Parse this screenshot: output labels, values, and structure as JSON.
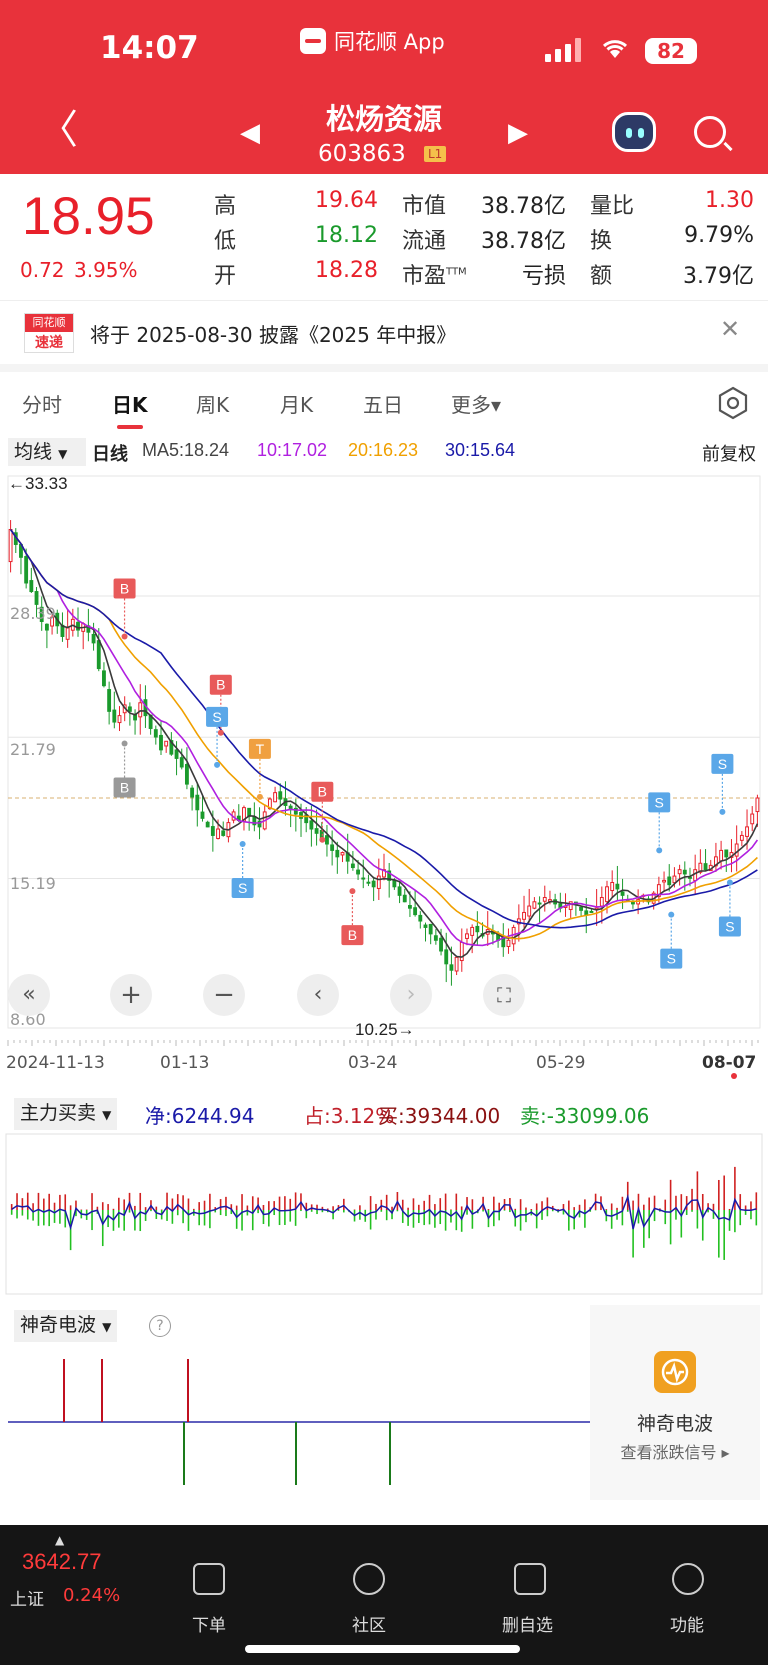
{
  "status_bar": {
    "time": "14:07",
    "app_label": "同花顺 App",
    "battery": "82"
  },
  "header": {
    "stock_name": "松炀资源",
    "stock_code": "603863",
    "level_badge": "L1"
  },
  "quote": {
    "price": "18.95",
    "change": "0.72",
    "change_pct": "3.95%",
    "high_label": "高",
    "high": "19.64",
    "low_label": "低",
    "low": "18.12",
    "open_label": "开",
    "open": "18.28",
    "mktcap_label": "市值",
    "mktcap": "38.78亿",
    "float_label": "流通",
    "float": "38.78亿",
    "pe_label": "市盈",
    "pe_sup": "TTM",
    "pe": "亏损",
    "volratio_label": "量比",
    "volratio": "1.30",
    "turnover_label": "换",
    "turnover": "9.79%",
    "amount_label": "额",
    "amount": "3.79亿"
  },
  "notice": {
    "logo_top": "同花顺",
    "logo_bottom": "速递",
    "text": "将于 2025-08-30 披露《2025 年中报》"
  },
  "tabs": [
    "分时",
    "日K",
    "周K",
    "月K",
    "五日",
    "更多▾"
  ],
  "ma_bar": {
    "selector": "均线",
    "period": "日线",
    "ma5": "MA5:18.24",
    "ma10": "10:17.02",
    "ma20": "20:16.23",
    "ma30": "30:15.64",
    "adjust": "前复权"
  },
  "chart_data": {
    "type": "candlestick",
    "y_ticks": [
      "28.39",
      "21.79",
      "15.19",
      "8.60"
    ],
    "high_marker": "←33.33",
    "low_marker": "10.25→",
    "x_ticks": [
      "2024-11-13",
      "01-13",
      "03-24",
      "05-29",
      "08-07"
    ],
    "current_price_line": 18.95,
    "close_series": [
      31.5,
      30.8,
      30.2,
      29.0,
      28.6,
      28.0,
      27.2,
      26.8,
      27.4,
      27.0,
      26.5,
      26.9,
      27.3,
      26.8,
      27.1,
      26.7,
      26.2,
      25.0,
      24.2,
      23.0,
      22.5,
      22.8,
      23.3,
      23.0,
      22.6,
      23.4,
      22.8,
      22.2,
      21.8,
      21.2,
      21.6,
      21.0,
      20.8,
      20.4,
      19.6,
      19.0,
      18.4,
      18.0,
      17.6,
      17.2,
      17.5,
      17.2,
      17.8,
      18.3,
      17.9,
      18.5,
      18.1,
      17.7,
      17.6,
      18.3,
      18.9,
      19.2,
      18.9,
      18.6,
      18.4,
      18.2,
      18.0,
      17.8,
      17.5,
      17.3,
      17.0,
      16.8,
      16.5,
      16.2,
      16.4,
      16.0,
      15.7,
      15.4,
      15.2,
      15.0,
      14.8,
      15.3,
      15.6,
      15.1,
      14.8,
      14.4,
      14.1,
      13.8,
      13.5,
      13.2,
      12.9,
      12.6,
      12.3,
      11.8,
      11.2,
      10.9,
      11.5,
      12.2,
      12.6,
      12.9,
      12.7,
      12.5,
      12.8,
      12.6,
      12.3,
      12.0,
      12.3,
      12.9,
      13.3,
      13.6,
      13.9,
      14.1,
      14.0,
      14.3,
      14.2,
      14.0,
      13.8,
      13.9,
      14.1,
      14.0,
      13.7,
      13.5,
      13.6,
      13.8,
      14.3,
      14.8,
      15.0,
      14.7,
      14.4,
      14.2,
      14.0,
      14.2,
      14.4,
      14.1,
      14.5,
      14.9,
      15.1,
      14.9,
      15.3,
      15.6,
      15.4,
      15.2,
      15.6,
      15.9,
      15.6,
      15.8,
      16.2,
      16.5,
      16.2,
      16.4,
      16.8,
      17.2,
      17.6,
      18.2,
      18.95
    ],
    "ma_colors": {
      "ma5": "#3a3a3a",
      "ma10": "#b020e0",
      "ma20": "#f0a000",
      "ma30": "#1a1aa8"
    },
    "signals": [
      {
        "label": "B",
        "x": 0.155,
        "price": 26.5,
        "pos": "above",
        "color": "#e85a5a"
      },
      {
        "label": "B",
        "x": 0.155,
        "price": 21.5,
        "pos": "below",
        "color": "#999999"
      },
      {
        "label": "B",
        "x": 0.283,
        "price": 22.0,
        "pos": "above",
        "color": "#e85a5a"
      },
      {
        "label": "S",
        "x": 0.278,
        "price": 20.5,
        "pos": "above",
        "color": "#5aa7e8"
      },
      {
        "label": "T",
        "x": 0.335,
        "price": 19.0,
        "pos": "above",
        "color": "#f0a040"
      },
      {
        "label": "S",
        "x": 0.312,
        "price": 16.8,
        "pos": "below",
        "color": "#5aa7e8"
      },
      {
        "label": "B",
        "x": 0.418,
        "price": 17.0,
        "pos": "above",
        "color": "#e85a5a"
      },
      {
        "label": "B",
        "x": 0.458,
        "price": 14.6,
        "pos": "below",
        "color": "#e85a5a"
      },
      {
        "label": "S",
        "x": 0.866,
        "price": 16.5,
        "pos": "above",
        "color": "#5aa7e8"
      },
      {
        "label": "S",
        "x": 0.882,
        "price": 13.5,
        "pos": "below",
        "color": "#5aa7e8"
      },
      {
        "label": "S",
        "x": 0.95,
        "price": 18.3,
        "pos": "above",
        "color": "#5aa7e8"
      },
      {
        "label": "S",
        "x": 0.96,
        "price": 15.0,
        "pos": "below",
        "color": "#5aa7e8"
      }
    ]
  },
  "chart_controls": [
    "zoom-in",
    "zoom-out",
    "pan-left",
    "pan-right",
    "fullscreen"
  ],
  "main_force": {
    "selector": "主力买卖",
    "net": "净:6244.94",
    "ratio": "占:3.12%",
    "buy": "买:39344.00",
    "sell": "卖:-33099.06"
  },
  "wave": {
    "selector": "神奇电波",
    "help": "?",
    "promo_title": "神奇电波",
    "promo_sub": "查看涨跌信号 ▸"
  },
  "bottom": {
    "index_value": "3642.77",
    "index_name": "上证",
    "index_pct": "0.24%",
    "nav": [
      "下单",
      "社区",
      "删自选",
      "功能"
    ]
  }
}
